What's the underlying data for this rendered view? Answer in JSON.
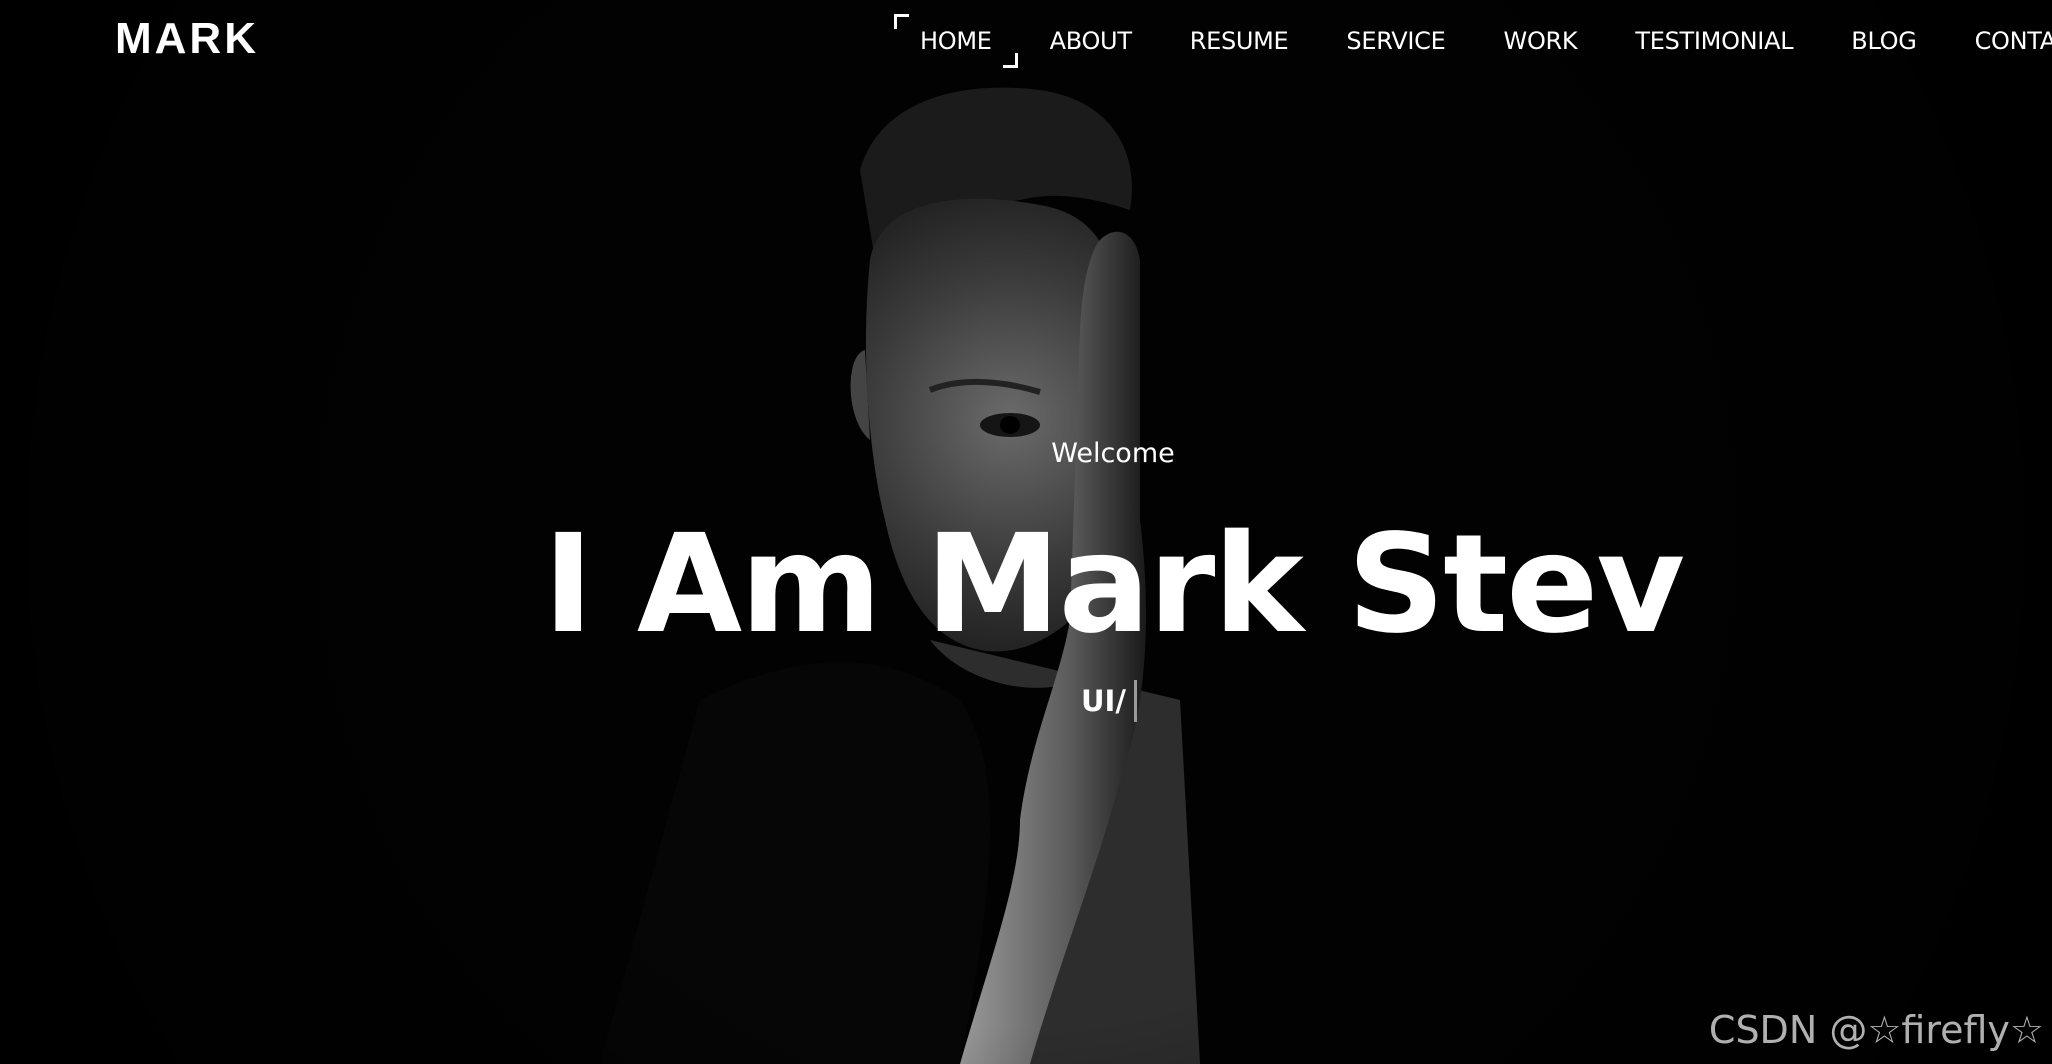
{
  "brand": {
    "logo_text": "MARK"
  },
  "nav": {
    "items": [
      {
        "label": "HOME",
        "active": true
      },
      {
        "label": "ABOUT",
        "active": false
      },
      {
        "label": "RESUME",
        "active": false
      },
      {
        "label": "SERVICE",
        "active": false
      },
      {
        "label": "WORK",
        "active": false
      },
      {
        "label": "TESTIMONIAL",
        "active": false
      },
      {
        "label": "BLOG",
        "active": false
      },
      {
        "label": "CONTA",
        "active": false
      }
    ]
  },
  "hero": {
    "welcome": "Welcome",
    "title": "I Am Mark Stev",
    "subtitle": "UI/"
  },
  "watermark": {
    "text": "CSDN @☆firefly☆"
  },
  "colors": {
    "background": "#000000",
    "text": "#ffffff",
    "cursor": "#9a9a9a"
  }
}
